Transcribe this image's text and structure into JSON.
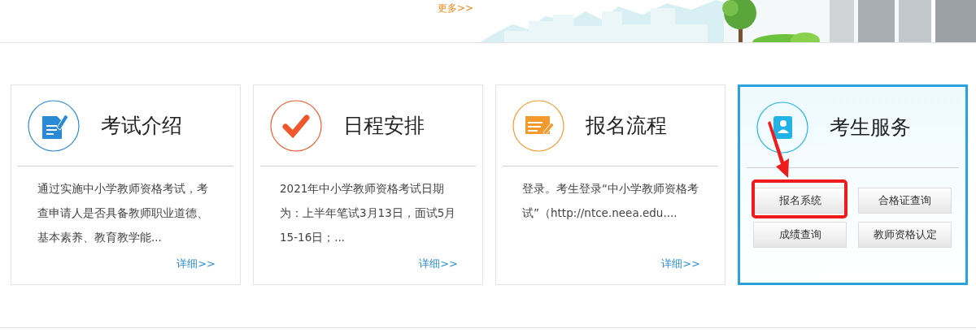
{
  "header": {
    "more_link": "更多>>"
  },
  "cards": [
    {
      "kind": "document",
      "color": "#2b8ad6",
      "title": "考试介绍",
      "selected": false,
      "description": "通过实施中小学教师资格考试，考查申请人是否具备教师职业道德、基本素养、教育教学能...",
      "link": "详细>>"
    },
    {
      "kind": "check",
      "color": "#f0582c",
      "title": "日程安排",
      "selected": false,
      "description": "2021年中小学教师资格考试日期为：上半年笔试3月13日，面试5月15-16日；...",
      "link": "详细>>"
    },
    {
      "kind": "form",
      "color": "#f29a2e",
      "title": "报名流程",
      "selected": false,
      "description": "登录。考生登录“中小学教师资格考试”（http://ntce.neea.edu....",
      "link": "详细>>"
    },
    {
      "kind": "person",
      "color": "#22b3e6",
      "title": "考生服务",
      "selected": true,
      "buttons": [
        {
          "label": "报名系统",
          "highlighted": true
        },
        {
          "label": "合格证查询",
          "highlighted": false
        },
        {
          "label": "成绩查询",
          "highlighted": false
        },
        {
          "label": "教师资格认定",
          "highlighted": false
        }
      ]
    }
  ]
}
